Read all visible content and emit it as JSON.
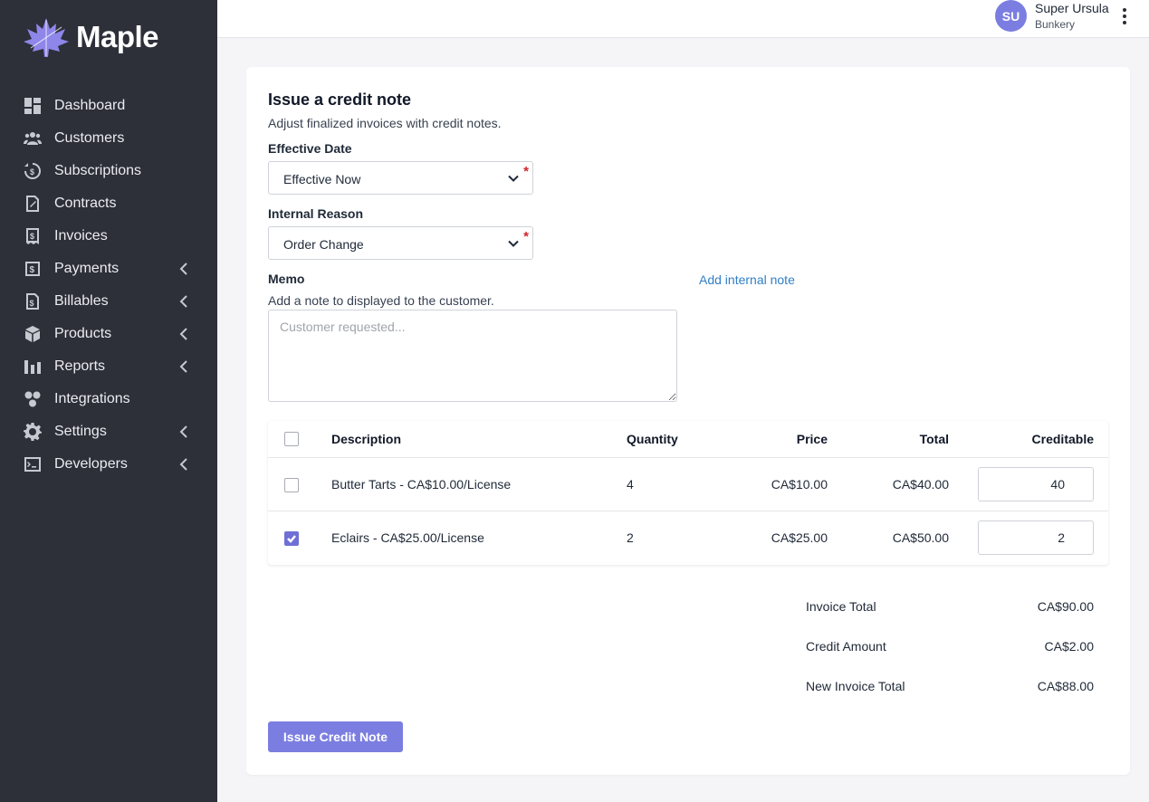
{
  "app": {
    "name": "Maple"
  },
  "sidebar": {
    "items": [
      {
        "label": "Dashboard",
        "icon": "dashboard-icon",
        "expandable": false
      },
      {
        "label": "Customers",
        "icon": "customers-icon",
        "expandable": false
      },
      {
        "label": "Subscriptions",
        "icon": "subscriptions-icon",
        "expandable": false
      },
      {
        "label": "Contracts",
        "icon": "contracts-icon",
        "expandable": false
      },
      {
        "label": "Invoices",
        "icon": "invoices-icon",
        "expandable": false
      },
      {
        "label": "Payments",
        "icon": "payments-icon",
        "expandable": true
      },
      {
        "label": "Billables",
        "icon": "billables-icon",
        "expandable": true
      },
      {
        "label": "Products",
        "icon": "products-icon",
        "expandable": true
      },
      {
        "label": "Reports",
        "icon": "reports-icon",
        "expandable": true
      },
      {
        "label": "Integrations",
        "icon": "integrations-icon",
        "expandable": false
      },
      {
        "label": "Settings",
        "icon": "gear-icon",
        "expandable": true
      },
      {
        "label": "Developers",
        "icon": "terminal-icon",
        "expandable": true
      }
    ]
  },
  "header": {
    "avatar_initials": "SU",
    "user_name": "Super Ursula",
    "user_org": "Bunkery"
  },
  "form": {
    "title": "Issue a credit note",
    "subtitle": "Adjust finalized invoices with credit notes.",
    "effective_date": {
      "label": "Effective Date",
      "value": "Effective Now",
      "required": "*"
    },
    "internal_reason": {
      "label": "Internal Reason",
      "value": "Order Change",
      "required": "*"
    },
    "memo": {
      "label": "Memo",
      "help": "Add a note to displayed to the customer.",
      "placeholder": "Customer requested...",
      "value": ""
    },
    "add_internal_note": "Add internal note"
  },
  "table": {
    "headers": {
      "description": "Description",
      "quantity": "Quantity",
      "price": "Price",
      "total": "Total",
      "creditable": "Creditable"
    },
    "rows": [
      {
        "checked": false,
        "description": "Butter Tarts - CA$10.00/License",
        "quantity": "4",
        "price": "CA$10.00",
        "total": "CA$40.00",
        "creditable": "40"
      },
      {
        "checked": true,
        "description": "Eclairs - CA$25.00/License",
        "quantity": "2",
        "price": "CA$25.00",
        "total": "CA$50.00",
        "creditable": "2"
      }
    ]
  },
  "totals": {
    "invoice_total": {
      "label": "Invoice Total",
      "value": "CA$90.00"
    },
    "credit_amount": {
      "label": "Credit Amount",
      "value": "CA$2.00"
    },
    "new_invoice_total": {
      "label": "New Invoice Total",
      "value": "CA$88.00"
    }
  },
  "actions": {
    "submit_label": "Issue Credit Note"
  },
  "colors": {
    "accent": "#7b7ee0",
    "sidebar_bg": "#2d2f39",
    "link": "#2f7fc7",
    "required": "#d0242b"
  }
}
